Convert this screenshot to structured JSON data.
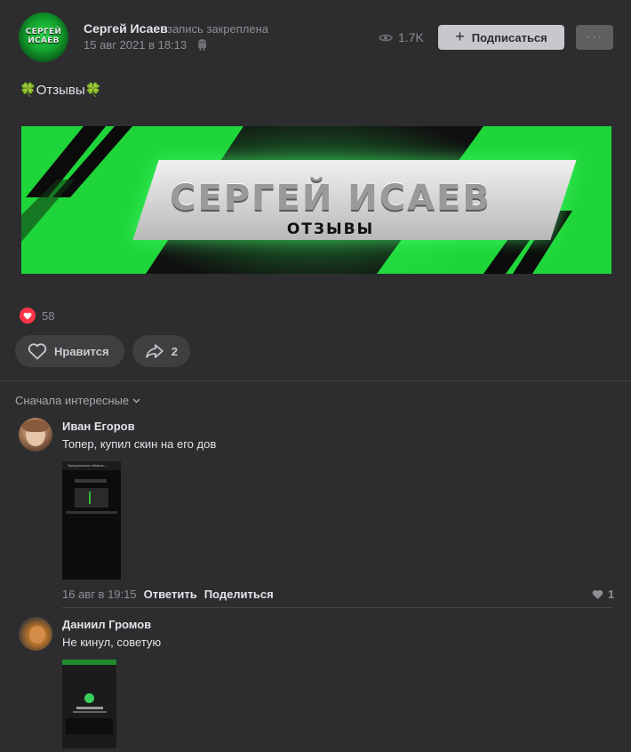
{
  "post": {
    "author": "Сергей Исаев",
    "pinned_note": "запись закреплена",
    "date": "15 авг 2021 в 18:13",
    "views": "1.7K",
    "subscribe_label": "Подписаться",
    "avatar_text_line1": "СЕРГЕЙ",
    "avatar_text_line2": "ИСАЕВ",
    "text": "Отзывы",
    "banner_title": "СЕРГЕЙ ИСАЕВ",
    "banner_subtitle": "ОТЗЫВЫ",
    "likes_count": "58",
    "like_button_label": "Нравится",
    "shares_count": "2"
  },
  "comments_header": {
    "sort_label": "Сначала интересные"
  },
  "comments": [
    {
      "name": "Иван Егоров",
      "text": "Топер, купил скин на его дов",
      "date": "16 авг в 19:15",
      "reply_label": "Ответить",
      "share_label": "Поделиться",
      "likes": "1",
      "attachment_title": "Предложение обмена..."
    },
    {
      "name": "Даниил Громов",
      "text": "Не кинул, советую"
    }
  ],
  "colors": {
    "background": "#2d2d2f",
    "accent_green": "#1fd63a",
    "like_red": "#ff3347"
  }
}
